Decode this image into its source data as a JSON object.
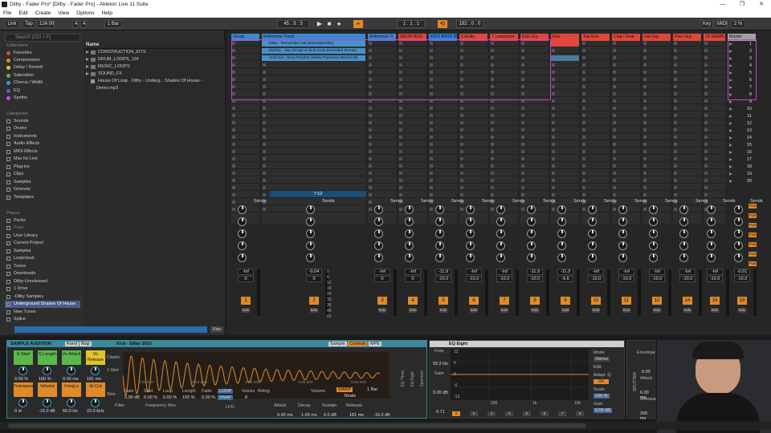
{
  "window": {
    "title": "Dilby - Fader Pro* [Dilby - Fader Pro] - Ableton Live 11 Suite",
    "controls": [
      "—",
      "❐",
      "✕"
    ]
  },
  "menu": [
    "File",
    "Edit",
    "Create",
    "View",
    "Options",
    "Help"
  ],
  "transport": {
    "link": "Link",
    "tap": "Tap",
    "tempo": "124.00",
    "signature_num": "4",
    "signature_den": "4",
    "quantize": "1 Bar",
    "position": "45 . 3 . 3",
    "loop_start": "1 . 1 . 1",
    "loop_length": "192 . 0 . 0",
    "key": "Key",
    "midi": "MIDI",
    "cpu": "2 %"
  },
  "browser": {
    "search_placeholder": "Search (Ctrl + F)",
    "collections_header": "Collections",
    "collections": [
      {
        "label": "Favorites",
        "color": "#e0473a"
      },
      {
        "label": "Compressors",
        "color": "#e08a2a"
      },
      {
        "label": "Delay / Reverb",
        "color": "#e0c42a"
      },
      {
        "label": "Saturation",
        "color": "#5ab84a"
      },
      {
        "label": "Chorus / Width",
        "color": "#3aa0c8"
      },
      {
        "label": "EQ",
        "color": "#6a5ad0"
      },
      {
        "label": "Synths",
        "color": "#b05ad0"
      }
    ],
    "categories_header": "Categories",
    "categories": [
      "Sounds",
      "Drums",
      "Instruments",
      "Audio Effects",
      "MIDI Effects",
      "Max for Live",
      "Plug-ins",
      "Clips",
      "Samples",
      "Grooves",
      "Templates"
    ],
    "places_header": "Places",
    "places": [
      "Packs",
      "Push",
      "User Library",
      "Current Project",
      "Samples",
      "Loopcloud",
      "Tunes",
      "Downloads",
      "Dilby Unreleased",
      "1 Drive",
      "-Dilby Samples",
      "Underground Shades Of House",
      "New Tunes",
      "Splice"
    ],
    "selected_place": "Underground Shades Of House",
    "name_header": "Name",
    "files": [
      "CONSTRUCTION_KITS",
      "DRUM_LOOPS_124",
      "MUSIC_LOOPS",
      "SOUND_FX",
      "House Of Loop - Dilby - Underg... Shades Of House - Demo.mp3"
    ],
    "raw_button": "Raw"
  },
  "tracks": [
    {
      "name": "Group",
      "color": "#3a8ad0"
    },
    {
      "name": "Reference Track",
      "color": "#3a8ad0"
    },
    {
      "name": "Reference Tr",
      "color": "#3a8ad0"
    },
    {
      "name": "DRUM BUS",
      "color": "#e0473a"
    },
    {
      "name": "KICK BASS BU",
      "color": "#2a8ae0"
    },
    {
      "name": "5 Audio",
      "color": "#e0473a"
    },
    {
      "name": "7 Loopcloud",
      "color": "#e0473a"
    },
    {
      "name": "Kick Grp",
      "color": "#e0473a"
    },
    {
      "name": "Kick",
      "color": "#e0473a"
    },
    {
      "name": "Top Kick",
      "color": "#e0473a"
    },
    {
      "name": "Clap / Snar",
      "color": "#e0473a"
    },
    {
      "name": "Hat Grp",
      "color": "#e0473a"
    },
    {
      "name": "Perc Grp",
      "color": "#e0473a"
    },
    {
      "name": "19 SAMPL",
      "color": "#e0473a"
    },
    {
      "name": "Master",
      "color": "#a0a0a0"
    }
  ],
  "clips": [
    "Dilby - Remember Me (Extended Mix)",
    "Dimitry - Jay (Gorge & Nick Curly Extended Remix)",
    "Soul Sal - Sexy Rhythm (Mihai Popoviciu Remix) Bil"
  ],
  "scenes": [
    "1",
    "2",
    "3",
    "4",
    "5",
    "6",
    "7",
    "8",
    "9",
    "10",
    "11",
    "12",
    "13",
    "14",
    "15",
    "16",
    "17",
    "18",
    "19",
    "20"
  ],
  "mixer": {
    "sends_label": "Sends",
    "reference_time": "7:12",
    "volumes": [
      "-Inf",
      "-0.04",
      "-Inf",
      "-Inf",
      "-11.9",
      "-Inf",
      "-Inf",
      "-11.9",
      "-11.9",
      "-Inf",
      "-Inf",
      "-Inf",
      "-Inf",
      "-Inf",
      "-0.01"
    ],
    "pans": [
      "0",
      "0",
      "0",
      "0",
      "-10.0",
      "-10.0",
      "-10.0",
      "-10.0",
      "-6.6",
      "-10.0",
      "-10.0",
      "-10.0",
      "-10.0",
      "-10.0",
      "-10.0"
    ],
    "numbers": [
      "1",
      "2",
      "3",
      "4",
      "5",
      "6",
      "7",
      "8",
      "9",
      "10",
      "11",
      "12",
      "14",
      "16",
      "19"
    ],
    "scale": [
      "0",
      "6",
      "12",
      "18",
      "24",
      "30",
      "36",
      "48",
      "60"
    ],
    "post_label": "Post",
    "solo_label": "Solo"
  },
  "sampler": {
    "title": "SAMPLE AUDITION",
    "rand": "Rand",
    "map": "Map",
    "macros": [
      {
        "label": "S Start",
        "value": "0.00 %",
        "color": "#5ab84a"
      },
      {
        "label": "S Length",
        "value": "100 %",
        "color": "#5ab84a"
      },
      {
        "label": "Vo Attack",
        "value": "0.00 ms",
        "color": "#5ab84a"
      },
      {
        "label": "Vo Release",
        "value": "181 ms",
        "color": "#e0c42a"
      },
      {
        "label": "Transpose",
        "value": "0 st",
        "color": "#e08a2a"
      },
      {
        "label": "Volume",
        "value": "-15.0 dB",
        "color": "#e08a2a"
      },
      {
        "label": "FreqLo",
        "value": "50.0 Hz",
        "color": "#e08a2a"
      },
      {
        "label": "Hi Cut",
        "value": "22.0 kHz",
        "color": "#e08a2a"
      }
    ],
    "sample_name": "Kick - Dilby 2023",
    "tabs": [
      "Sample",
      "Controls",
      "MPE"
    ],
    "mode": "Classic",
    "one_shot": "1-Shot",
    "slice": "Slice",
    "time_marks": [
      "0:00:000",
      "0:00:100",
      "0:00:200",
      "0:00:300",
      "0:00:400"
    ],
    "params": [
      {
        "label": "Gain",
        "value": "0.00 dB"
      },
      {
        "label": "Start",
        "value": "0.00 %"
      },
      {
        "label": "Loop",
        "value": "0.00 %"
      },
      {
        "label": "Length",
        "value": "100 %"
      },
      {
        "label": "Fade",
        "value": "0.00 %"
      }
    ],
    "loop_btn": "LOOP",
    "snap_btn": "SNAP",
    "voices_label": "Voices",
    "voices": "8",
    "retrig_label": "Retrig",
    "volume_label": "Volume",
    "warp": "WARP",
    "beats": "Beats",
    "bar_value": "1 Bar",
    "filter": "Filter",
    "frequency": "Frequency",
    "res": "Res",
    "lfo": "LFO",
    "attack_label": "Attack",
    "attack": "0.00 ms",
    "decay_label": "Decay",
    "decay": "1.00 ms",
    "sustain_label": "Sustain",
    "sustain": "0.0 dB",
    "release_label": "Release",
    "release": "181 ms",
    "out": "-15.0 dB",
    "side_labels": [
      "EQ Three",
      "EQ Eight",
      "Spectrum"
    ]
  },
  "eq": {
    "title": "EQ Eight",
    "freq_label": "Freq",
    "freq_value": "93.2 Hz",
    "gain_label": "Gain",
    "gain_value": "0.00 dB",
    "q_value": "0.71",
    "db_marks": [
      "12",
      "6",
      "0",
      "-6",
      "-12"
    ],
    "freq_marks": [
      "100",
      "1k",
      "10k"
    ],
    "mode_label": "Mode",
    "mode_value": "Stereo",
    "edit": "Edit",
    "adapt_label": "Adapt. Q",
    "adapt_value": "On",
    "scale_label": "Scale",
    "scale_value": "100 %",
    "gain_out_label": "Gain",
    "gain_out_value": "0.00 dB",
    "bands": [
      "1",
      "2",
      "3",
      "4",
      "5",
      "6",
      "7",
      "8"
    ]
  },
  "envelope": {
    "title": "Envelope",
    "value": "0.00",
    "attack_label": "Attack",
    "attack_value": "6.00 ms",
    "release_label": "Release",
    "release_value": "200 ms",
    "side_label": "SPLITTER"
  }
}
